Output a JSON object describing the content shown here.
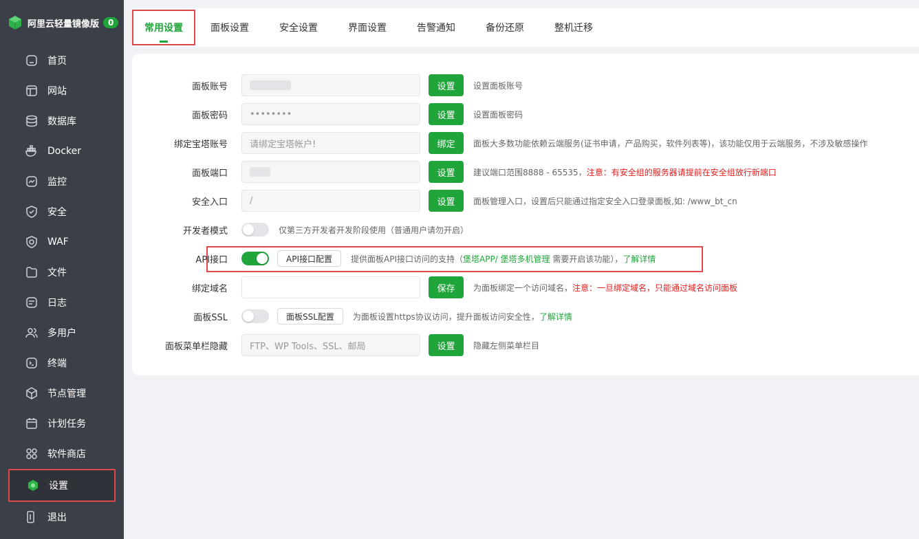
{
  "brand": {
    "title": "阿里云轻量镜像版",
    "badge": "0"
  },
  "sidebar": {
    "items": [
      {
        "label": "首页",
        "icon": "home-icon"
      },
      {
        "label": "网站",
        "icon": "website-icon"
      },
      {
        "label": "数据库",
        "icon": "database-icon"
      },
      {
        "label": "Docker",
        "icon": "docker-icon"
      },
      {
        "label": "监控",
        "icon": "monitor-icon"
      },
      {
        "label": "安全",
        "icon": "shield-icon"
      },
      {
        "label": "WAF",
        "icon": "globe-icon"
      },
      {
        "label": "文件",
        "icon": "folder-icon"
      },
      {
        "label": "日志",
        "icon": "log-icon"
      },
      {
        "label": "多用户",
        "icon": "users-icon"
      },
      {
        "label": "终端",
        "icon": "terminal-icon"
      },
      {
        "label": "节点管理",
        "icon": "cube-icon"
      },
      {
        "label": "计划任务",
        "icon": "calendar-icon"
      },
      {
        "label": "软件商店",
        "icon": "apps-icon"
      },
      {
        "label": "设置",
        "icon": "settings-icon",
        "active": true
      },
      {
        "label": "退出",
        "icon": "logout-icon"
      }
    ]
  },
  "tabs": [
    "常用设置",
    "面板设置",
    "安全设置",
    "界面设置",
    "告警通知",
    "备份还原",
    "整机迁移"
  ],
  "settings": {
    "account": {
      "label": "面板账号",
      "button": "设置",
      "hint": "设置面板账号"
    },
    "password": {
      "label": "面板密码",
      "value": "••••••••",
      "button": "设置",
      "hint": "设置面板密码"
    },
    "bind_bt": {
      "label": "绑定宝塔账号",
      "placeholder": "请绑定宝塔帐户!",
      "button": "绑定",
      "hint": "面板大多数功能依赖云端服务(证书申请，产品购买，软件列表等)，该功能仅用于云端服务，不涉及敏感操作"
    },
    "port": {
      "label": "面板端口",
      "button": "设置",
      "hint": "建议端口范围8888 - 65535，",
      "hint_warn": "注意：有安全组的服务器请提前在安全组放行新端口"
    },
    "entry": {
      "label": "安全入口",
      "value": "/",
      "button": "设置",
      "hint": "面板管理入口，设置后只能通过指定安全入口登录面板,如: /www_bt_cn"
    },
    "dev_mode": {
      "label": "开发者模式",
      "enabled": false,
      "hint": "仅第三方开发者开发阶段使用（普通用户请勿开启）"
    },
    "api": {
      "label": "API接口",
      "enabled": true,
      "button": "API接口配置",
      "hint_pre": "提供面板API接口访问的支持（",
      "hint_links": "堡塔APP/ 堡塔多机管理",
      "hint_mid": " 需要开启该功能），",
      "hint_more": "了解详情"
    },
    "domain": {
      "label": "绑定域名",
      "button": "保存",
      "hint": "为面板绑定一个访问域名，",
      "hint_warn": "注意：一旦绑定域名，只能通过域名访问面板"
    },
    "ssl": {
      "label": "面板SSL",
      "enabled": false,
      "button": "面板SSL配置",
      "hint": "为面板设置https协议访问，提升面板访问安全性，",
      "hint_more": "了解详情"
    },
    "menu_hide": {
      "label": "面板菜单栏隐藏",
      "placeholder": "FTP、WP Tools、SSL、邮局",
      "button": "设置",
      "hint": "隐藏左侧菜单栏目"
    }
  },
  "colors": {
    "accent": "#20a53a",
    "sidebar_bg": "#3b3f47",
    "warn": "#e02020",
    "highlight_box": "#e0484c"
  }
}
